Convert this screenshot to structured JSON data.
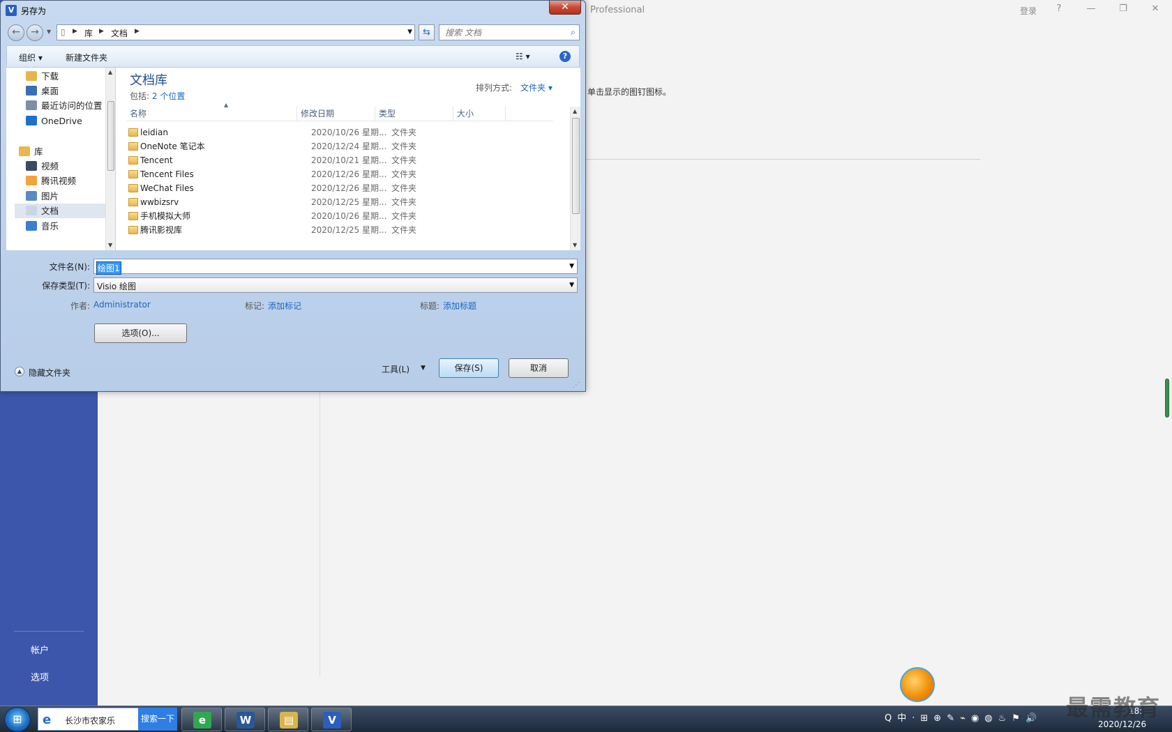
{
  "visio": {
    "app_title": "Professional",
    "login": "登录",
    "help": "?",
    "minimize": "—",
    "restore": "❐",
    "close": "✕",
    "pin_hint": "单击显示的图钉图标。",
    "nav": {
      "account": "帐户",
      "options": "选项"
    }
  },
  "dialog": {
    "title": "另存为",
    "app_icon": "V",
    "close": "✕",
    "address": {
      "seg1": "库",
      "seg2": "文档"
    },
    "search_placeholder": "搜索 文档",
    "toolbar": {
      "organize": "组织 ▾",
      "new_folder": "新建文件夹",
      "view": "☷ ▾",
      "help": "?"
    },
    "nav_pane": [
      {
        "label": "下载",
        "icon": "download-folder-icon",
        "color": "#e6b64a"
      },
      {
        "label": "桌面",
        "icon": "desktop-icon",
        "color": "#3a6fb5"
      },
      {
        "label": "最近访问的位置",
        "icon": "recent-places-icon",
        "color": "#7a8fa8"
      },
      {
        "label": "OneDrive",
        "icon": "onedrive-icon",
        "color": "#1f6fd0"
      },
      {
        "label": "库",
        "icon": "libraries-icon",
        "color": "#e7b84a"
      },
      {
        "label": "视频",
        "icon": "videos-icon",
        "color": "#3a4a64"
      },
      {
        "label": "腾讯视频",
        "icon": "tencent-video-icon",
        "color": "#f2a33a"
      },
      {
        "label": "图片",
        "icon": "pictures-icon",
        "color": "#5b8ac2"
      },
      {
        "label": "文档",
        "icon": "documents-icon",
        "color": "#c9d6e6"
      },
      {
        "label": "音乐",
        "icon": "music-icon",
        "color": "#3a7fd0"
      }
    ],
    "library": {
      "title": "文档库",
      "includes_label": "包括:",
      "includes_link": "2 个位置",
      "arrange_label": "排列方式:",
      "arrange_value": "文件夹 ▾"
    },
    "columns": {
      "name": "名称",
      "date": "修改日期",
      "type": "类型",
      "size": "大小"
    },
    "files": [
      {
        "name": "leidian",
        "date": "2020/10/26 星期...",
        "type": "文件夹"
      },
      {
        "name": "OneNote 笔记本",
        "date": "2020/12/24 星期...",
        "type": "文件夹"
      },
      {
        "name": "Tencent",
        "date": "2020/10/21 星期...",
        "type": "文件夹"
      },
      {
        "name": "Tencent Files",
        "date": "2020/12/26 星期...",
        "type": "文件夹"
      },
      {
        "name": "WeChat Files",
        "date": "2020/12/26 星期...",
        "type": "文件夹"
      },
      {
        "name": "wwbizsrv",
        "date": "2020/12/25 星期...",
        "type": "文件夹"
      },
      {
        "name": "手机模拟大师",
        "date": "2020/10/26 星期...",
        "type": "文件夹"
      },
      {
        "name": "腾讯影视库",
        "date": "2020/12/25 星期...",
        "type": "文件夹"
      }
    ],
    "form": {
      "filename_label": "文件名(N):",
      "filename_value": "绘图1",
      "savetype_label": "保存类型(T):",
      "savetype_value": "Visio 绘图",
      "author_label": "作者:",
      "author_value": "Administrator",
      "tags_label": "标记:",
      "tags_value": "添加标记",
      "title_label": "标题:",
      "title_value": "添加标题",
      "options_button": "选项(O)...",
      "hide_folders": "隐藏文件夹",
      "tools": "工具(L)",
      "save": "保存(S)",
      "cancel": "取消"
    }
  },
  "taskbar": {
    "search_text": "长沙市农家乐",
    "search_button": "搜索一下",
    "apps": [
      {
        "name": "360-browser",
        "glyph": "e",
        "color": "#2fa84f"
      },
      {
        "name": "word",
        "glyph": "W",
        "color": "#2b5797"
      },
      {
        "name": "file-explorer",
        "glyph": "▤",
        "color": "#d9b44a"
      },
      {
        "name": "visio",
        "glyph": "V",
        "color": "#2a5fbf"
      }
    ],
    "tray": [
      "Q",
      "中",
      "·",
      "⊞",
      "⊕",
      "✎",
      "⌁",
      "◉",
      "◍",
      "♨",
      "⚑",
      "🔊"
    ],
    "time": "18:",
    "date": "2020/12/26"
  },
  "watermark": "最需教育"
}
